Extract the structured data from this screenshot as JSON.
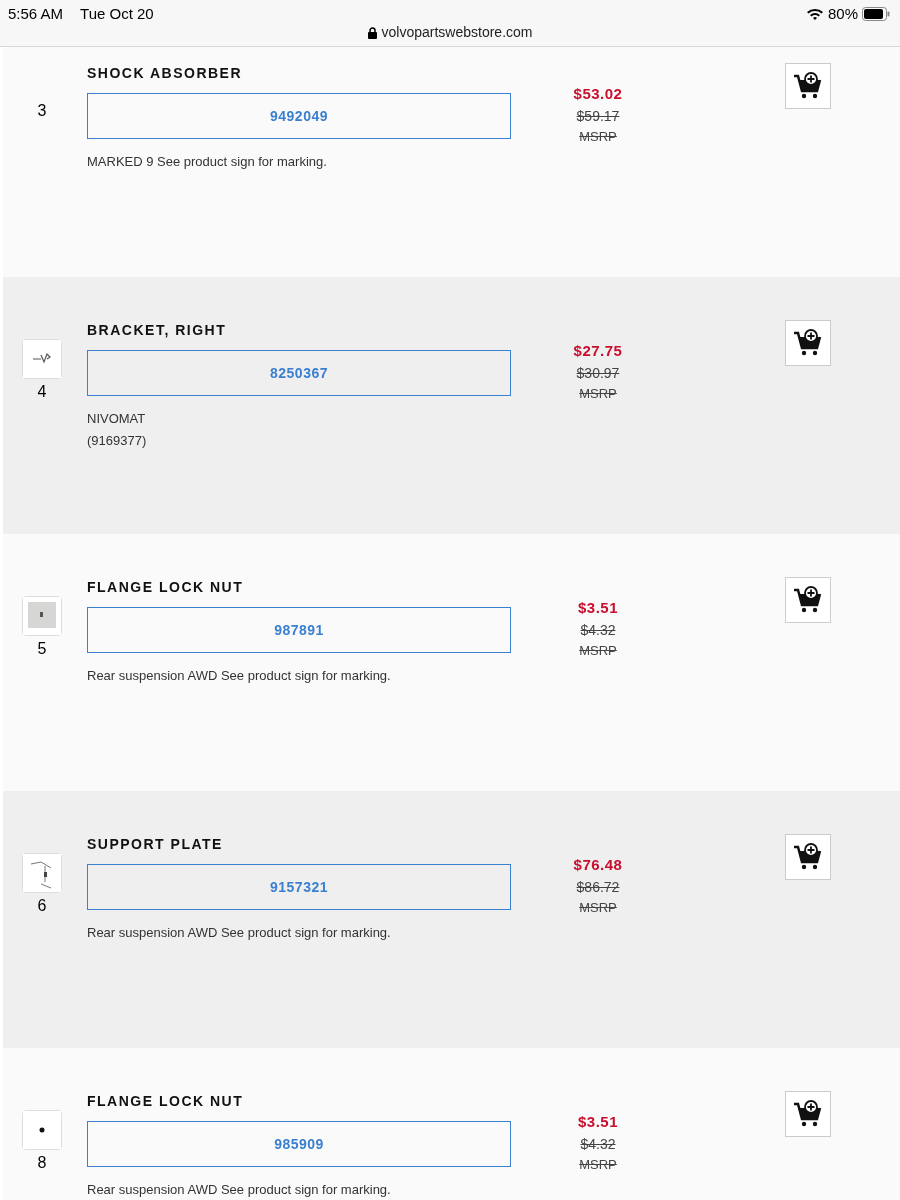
{
  "status_bar": {
    "time": "5:56 AM",
    "date": "Tue Oct 20",
    "url": "volvopartswebstore.com",
    "battery": "80%"
  },
  "parts": [
    {
      "number": "3",
      "title": "SHOCK ABSORBER",
      "part_no": "9492049",
      "price": "$53.02",
      "old_price": "$59.17",
      "msrp": "MSRP",
      "notes": [
        "MARKED 9 See product sign for marking."
      ]
    },
    {
      "number": "4",
      "title": "BRACKET, RIGHT",
      "part_no": "8250367",
      "price": "$27.75",
      "old_price": "$30.97",
      "msrp": "MSRP",
      "notes": [
        "NIVOMAT",
        "(9169377)"
      ],
      "thumbnail": {
        "kind": "picture"
      }
    },
    {
      "number": "5",
      "title": "FLANGE LOCK NUT",
      "part_no": "987891",
      "price": "$3.51",
      "old_price": "$4.32",
      "msrp": "MSRP",
      "notes": [
        "Rear suspension AWD See product sign for marking."
      ],
      "thumbnail": {
        "kind": "picture"
      }
    },
    {
      "number": "6",
      "title": "SUPPORT PLATE",
      "part_no": "9157321",
      "price": "$76.48",
      "old_price": "$86.72",
      "msrp": "MSRP",
      "notes": [
        "Rear suspension AWD See product sign for marking."
      ],
      "thumbnail": {
        "kind": "picture"
      }
    },
    {
      "number": "8",
      "title": "FLANGE LOCK NUT",
      "part_no": "985909",
      "price": "$3.51",
      "old_price": "$4.32",
      "msrp": "MSRP",
      "notes": [
        "Rear suspension AWD See product sign for marking."
      ],
      "thumbnail": {
        "kind": "picture"
      }
    }
  ]
}
